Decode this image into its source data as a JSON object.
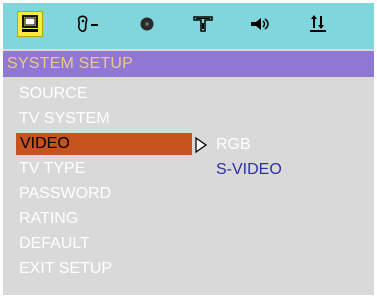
{
  "tabs": [
    {
      "icon": "monitor-icon",
      "selected": true
    },
    {
      "icon": "language-icon",
      "selected": false
    },
    {
      "icon": "disc-icon",
      "selected": false
    },
    {
      "icon": "speaker-icon",
      "selected": false
    },
    {
      "icon": "audio-icon",
      "selected": false
    },
    {
      "icon": "equalizer-icon",
      "selected": false
    }
  ],
  "title": "SYSTEM SETUP",
  "menu": [
    {
      "label": "SOURCE"
    },
    {
      "label": "TV SYSTEM"
    },
    {
      "label": "VIDEO",
      "selected": true
    },
    {
      "label": "TV TYPE"
    },
    {
      "label": "PASSWORD"
    },
    {
      "label": "RATING"
    },
    {
      "label": "DEFAULT"
    },
    {
      "label": "EXIT SETUP"
    }
  ],
  "options": [
    {
      "label": "RGB",
      "state": "dim"
    },
    {
      "label": "S-VIDEO",
      "state": "active"
    }
  ],
  "colors": {
    "icon_bar": "#7fd6dc",
    "title_bar": "#8e78d4",
    "title_text": "#f0c98a",
    "panel": "#d9d9d9",
    "selected_item": "#c6521d",
    "selected_tab": "#f5ec3e",
    "active_option": "#2a2fa5"
  }
}
